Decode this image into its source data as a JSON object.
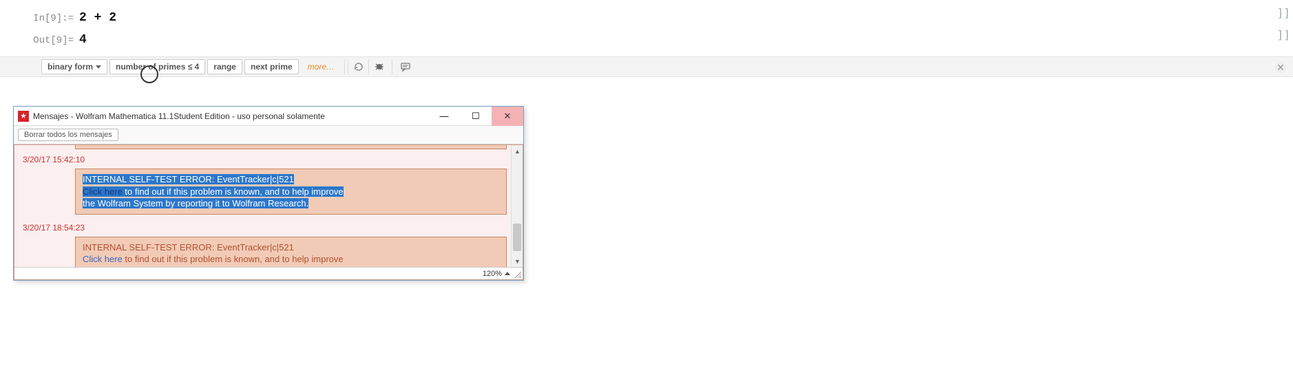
{
  "notebook": {
    "in_label": "In[9]:=",
    "in_expr": "2 + 2",
    "out_label": "Out[9]=",
    "out_expr": "4",
    "brackets": "]]"
  },
  "suggestions": {
    "items": [
      {
        "label": "binary form",
        "has_dropdown": true
      },
      {
        "label": "number of primes ≤ 4",
        "has_dropdown": false
      },
      {
        "label": "range",
        "has_dropdown": false
      },
      {
        "label": "next prime",
        "has_dropdown": false
      }
    ],
    "more": "more…"
  },
  "dialog": {
    "title": "Mensajes - Wolfram Mathematica 11.1Student Edition - uso personal solamente",
    "clear": "Borrar todos los mensajes",
    "zoom": "120%",
    "messages": [
      {
        "timestamp": "3/20/17 15:42:10",
        "selected": true,
        "line1": "INTERNAL SELF-TEST ERROR: EventTracker|c|521",
        "link": "Click here",
        "rest": " to find out if this problem is known, and to help improve",
        "line3": "the Wolfram System by reporting it to Wolfram Research."
      },
      {
        "timestamp": "3/20/17 18:54:23",
        "selected": false,
        "line1": "INTERNAL SELF-TEST ERROR: EventTracker|c|521",
        "link": "Click here",
        "rest": " to find out if this problem is known, and to help improve",
        "line3": ""
      }
    ]
  }
}
